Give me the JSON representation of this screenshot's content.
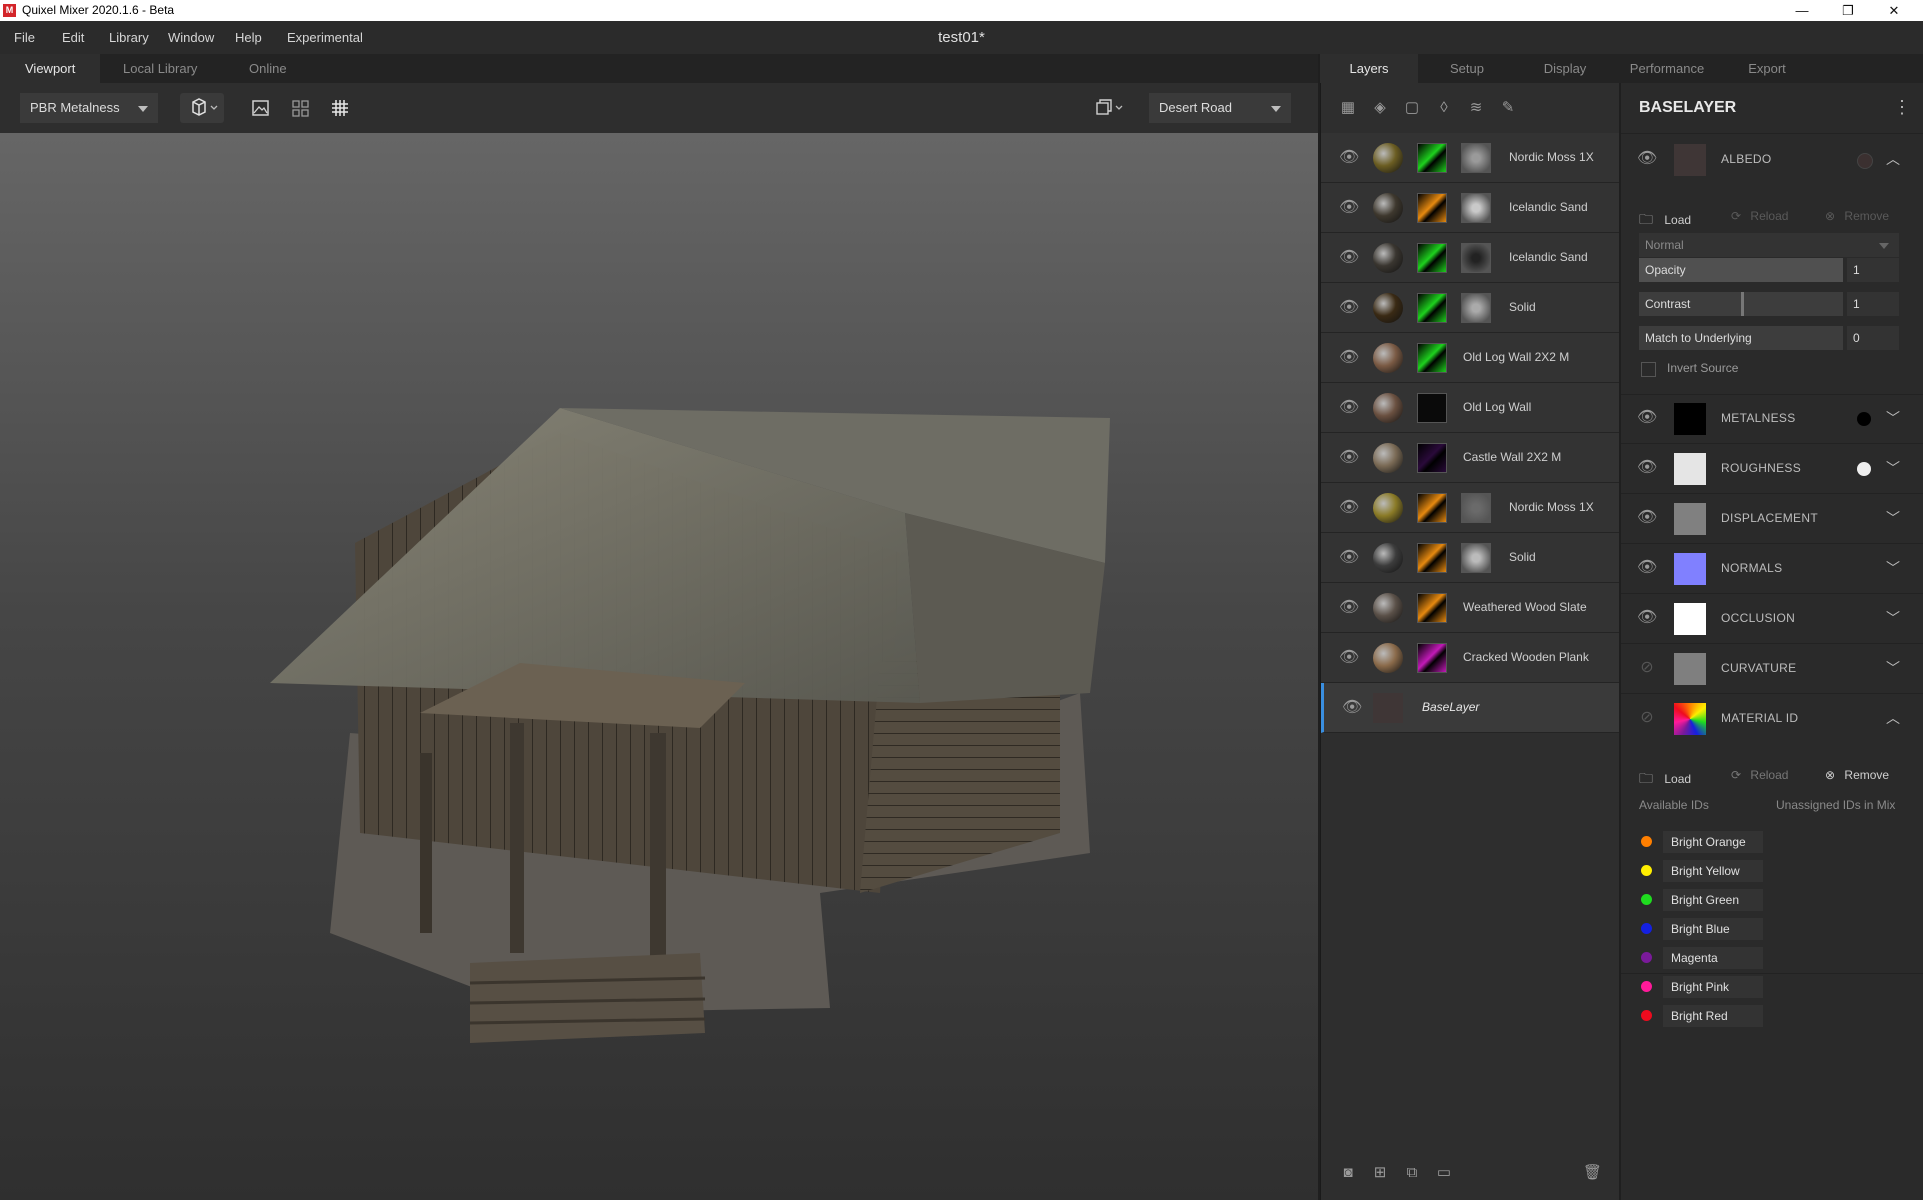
{
  "window": {
    "title": "Quixel Mixer 2020.1.6 - Beta",
    "logo": "M",
    "min": "—",
    "max": "❐",
    "close": "✕"
  },
  "menu": {
    "items": [
      "File",
      "Edit",
      "Library",
      "Window",
      "Help",
      "Experimental"
    ],
    "document_title": "test01*"
  },
  "viewport": {
    "tabs": [
      "Viewport",
      "Local Library",
      "Online"
    ],
    "active_tab": "Viewport",
    "shading_mode": "PBR Metalness",
    "environment": "Desert Road"
  },
  "layers": {
    "tabs": [
      "Layers",
      "Setup",
      "Display",
      "Performance",
      "Export"
    ],
    "active_tab": "Layers",
    "items": [
      {
        "name": "Nordic Moss 1X",
        "ball": "#6b5d22",
        "mask": "green",
        "extra": true,
        "extra_color": "#9a9a9a"
      },
      {
        "name": "Icelandic Sand",
        "ball": "#3e382e",
        "mask": "orange",
        "extra": true,
        "extra_color": "#c9c9c9"
      },
      {
        "name": "Icelandic Sand",
        "ball": "#3a3630",
        "mask": "green",
        "extra": true,
        "extra_color": "#222222"
      },
      {
        "name": "Solid",
        "ball": "#3a2a14",
        "mask": "green",
        "extra": true,
        "extra_color": "#aaaaaa"
      },
      {
        "name": "Old Log Wall 2X2 M",
        "ball": "#7a5a44",
        "mask": "green",
        "extra": false
      },
      {
        "name": "Old Log Wall",
        "ball": "#6a5040",
        "mask": "dark",
        "extra": false
      },
      {
        "name": "Castle Wall 2X2 M",
        "ball": "#7a6a55",
        "mask": "purple",
        "extra": false
      },
      {
        "name": "Nordic Moss 1X",
        "ball": "#8a7a26",
        "mask": "orange",
        "extra": true,
        "extra_color": "#6a6a6a"
      },
      {
        "name": "Solid",
        "ball": "#3c3c3c",
        "mask": "orange",
        "extra": true,
        "extra_color": "#bbbbbb"
      },
      {
        "name": "Weathered Wood Slate",
        "ball": "#5a5048",
        "mask": "orange",
        "extra": false
      },
      {
        "name": "Cracked Wooden Plank",
        "ball": "#8a6a4a",
        "mask": "magenta",
        "extra": false
      },
      {
        "name": "BaseLayer",
        "ball": "#3f3636",
        "mask": "none",
        "extra": false
      }
    ]
  },
  "props": {
    "title": "BASELAYER",
    "albedo": {
      "label": "ALBEDO",
      "load": "Load",
      "reload": "Reload",
      "remove": "Remove",
      "blend": "Normal",
      "opacity_label": "Opacity",
      "opacity": "1",
      "contrast_label": "Contrast",
      "contrast": "1",
      "match_label": "Match to Underlying",
      "match": "0",
      "invert_label": "Invert Source"
    },
    "channels": [
      {
        "label": "METALNESS",
        "color": "#000000",
        "dot": "#000000",
        "hidden": false
      },
      {
        "label": "ROUGHNESS",
        "color": "#e5e5e5",
        "dot": "#eeeeee",
        "hidden": false
      },
      {
        "label": "DISPLACEMENT",
        "color": "#808080",
        "dot": "",
        "hidden": false
      },
      {
        "label": "NORMALS",
        "color": "#8080ff",
        "dot": "",
        "hidden": false
      },
      {
        "label": "OCCLUSION",
        "color": "#ffffff",
        "dot": "",
        "hidden": false
      },
      {
        "label": "CURVATURE",
        "color": "#7f7f7f",
        "dot": "",
        "hidden": true
      }
    ],
    "material_id": {
      "label": "MATERIAL ID",
      "load": "Load",
      "reload": "Reload",
      "remove": "Remove",
      "available": "Available IDs",
      "unassigned": "Unassigned IDs in Mix",
      "ids": [
        {
          "name": "Bright Orange",
          "color": "#ff7f00"
        },
        {
          "name": "Bright Yellow",
          "color": "#ffee00"
        },
        {
          "name": "Bright Green",
          "color": "#1fdc1f"
        },
        {
          "name": "Bright Blue",
          "color": "#1420e0"
        },
        {
          "name": "Magenta",
          "color": "#7a1a9a"
        },
        {
          "name": "Bright Pink",
          "color": "#ff1a9a"
        },
        {
          "name": "Bright Red",
          "color": "#ee0b1e"
        }
      ]
    }
  }
}
